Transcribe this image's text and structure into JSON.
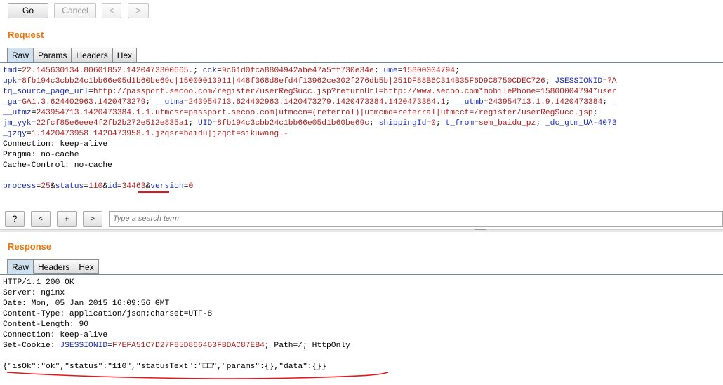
{
  "toolbar": {
    "go": "Go",
    "cancel": "Cancel",
    "back": "<",
    "forward": ">"
  },
  "request": {
    "title": "Request",
    "tabs": [
      "Raw",
      "Params",
      "Headers",
      "Hex"
    ],
    "lines": [
      [
        [
          "k",
          "tmd"
        ],
        [
          "p",
          "="
        ],
        [
          "v",
          "22.145630134.80601852.1420473300665."
        ],
        [
          "p",
          "; "
        ],
        [
          "k",
          "cck"
        ],
        [
          "p",
          "="
        ],
        [
          "v",
          "9c61d0fca8804942abe47a5ff730e34e"
        ],
        [
          "p",
          "; "
        ],
        [
          "k",
          "ume"
        ],
        [
          "p",
          "="
        ],
        [
          "v",
          "15800004794"
        ],
        [
          "p",
          ";"
        ]
      ],
      [
        [
          "k",
          "upk"
        ],
        [
          "p",
          "="
        ],
        [
          "v",
          "8fb194c3cbb24c1bb66e05d1b60be69c|15000013911|448f368d8efd4f13962ce302f276db5b|251DF88B6C314B35F6D9C8750CDEC726"
        ],
        [
          "p",
          "; "
        ],
        [
          "k",
          "JSESSIONID"
        ],
        [
          "p",
          "="
        ],
        [
          "v",
          "7A"
        ]
      ],
      [
        [
          "k",
          "tq_source_page_url"
        ],
        [
          "p",
          "="
        ],
        [
          "v",
          "http://passport.secoo.com/register/userRegSucc.jsp?returnUrl=http://www.secoo.com*mobilePhone=15800004794*user"
        ]
      ],
      [
        [
          "k",
          "_ga"
        ],
        [
          "p",
          "="
        ],
        [
          "v",
          "GA1.3.624402963.1420473279"
        ],
        [
          "p",
          "; "
        ],
        [
          "k",
          "__utma"
        ],
        [
          "p",
          "="
        ],
        [
          "v",
          "243954713.624402963.1420473279.1420473384.1420473384.1"
        ],
        [
          "p",
          "; "
        ],
        [
          "k",
          "__utmb"
        ],
        [
          "p",
          "="
        ],
        [
          "v",
          "243954713.1.9.1420473384"
        ],
        [
          "p",
          "; "
        ],
        [
          "k",
          "_"
        ]
      ],
      [
        [
          "k",
          "__utmz"
        ],
        [
          "p",
          "="
        ],
        [
          "v",
          "243954713.1420473384.1.1.utmcsr=passport.secoo.com|utmccn=(referral)|utmcmd=referral|utmcct=/register/userRegSucc.jsp"
        ],
        [
          "p",
          ";"
        ]
      ],
      [
        [
          "k",
          "jm_yyk"
        ],
        [
          "p",
          "="
        ],
        [
          "v",
          "22fcf85e6eee4f2fb2b272e512e835a1"
        ],
        [
          "p",
          "; "
        ],
        [
          "k",
          "UID"
        ],
        [
          "p",
          "="
        ],
        [
          "v",
          "8fb194c3cbb24c1bb66e05d1b60be69c"
        ],
        [
          "p",
          "; "
        ],
        [
          "k",
          "shippingId"
        ],
        [
          "p",
          "="
        ],
        [
          "v",
          "0"
        ],
        [
          "p",
          "; "
        ],
        [
          "k",
          "t_from"
        ],
        [
          "p",
          "="
        ],
        [
          "v",
          "sem_baidu_pz"
        ],
        [
          "p",
          "; "
        ],
        [
          "k",
          "_dc_gtm_UA-4073"
        ]
      ],
      [
        [
          "k",
          "_jzqy"
        ],
        [
          "p",
          "="
        ],
        [
          "v",
          "1.1420473958.1420473958.1.jzqsr=baidu|jzqct=sikuwang.-"
        ]
      ],
      [
        [
          "p",
          "Connection: keep-alive"
        ]
      ],
      [
        [
          "p",
          "Pragma: no-cache"
        ]
      ],
      [
        [
          "p",
          "Cache-Control: no-cache"
        ]
      ],
      [
        [
          "p",
          ""
        ]
      ],
      [
        [
          "k",
          "process"
        ],
        [
          "p",
          "="
        ],
        [
          "v",
          "25"
        ],
        [
          "p",
          "&"
        ],
        [
          "k",
          "status"
        ],
        [
          "p",
          "="
        ],
        [
          "v",
          "110"
        ],
        [
          "p",
          "&"
        ],
        [
          "k",
          "id"
        ],
        [
          "p",
          "="
        ],
        [
          "v",
          "34463"
        ],
        [
          "p",
          "&"
        ],
        [
          "k",
          "version"
        ],
        [
          "p",
          "="
        ],
        [
          "v",
          "0"
        ]
      ]
    ]
  },
  "search": {
    "help": "?",
    "prev": "<",
    "add": "+",
    "next": ">",
    "placeholder": "Type a search term"
  },
  "response": {
    "title": "Response",
    "tabs": [
      "Raw",
      "Headers",
      "Hex"
    ],
    "lines": [
      [
        [
          "p",
          "HTTP/1.1 200 OK"
        ]
      ],
      [
        [
          "p",
          "Server: nginx"
        ]
      ],
      [
        [
          "p",
          "Date: Mon, 05 Jan 2015 16:09:56 GMT"
        ]
      ],
      [
        [
          "p",
          "Content-Type: application/json;charset=UTF-8"
        ]
      ],
      [
        [
          "p",
          "Content-Length: 90"
        ]
      ],
      [
        [
          "p",
          "Connection: keep-alive"
        ]
      ],
      [
        [
          "p",
          "Set-Cookie: "
        ],
        [
          "k",
          "JSESSIONID"
        ],
        [
          "p",
          "="
        ],
        [
          "v",
          "F7EFA51C7D27F85D866463FBDAC87EB4"
        ],
        [
          "p",
          "; Path=/; HttpOnly"
        ]
      ],
      [
        [
          "p",
          ""
        ]
      ],
      [
        [
          "p",
          "{\"isOk\":\"ok\",\"status\":\"110\",\"statusText\":\"□□\",\"params\":{},\"data\":{}}"
        ]
      ]
    ]
  },
  "colors": {
    "accent": "#e8770f",
    "key": "#1c2fb5",
    "value": "#b01e1e",
    "annotation": "#e8141b"
  }
}
